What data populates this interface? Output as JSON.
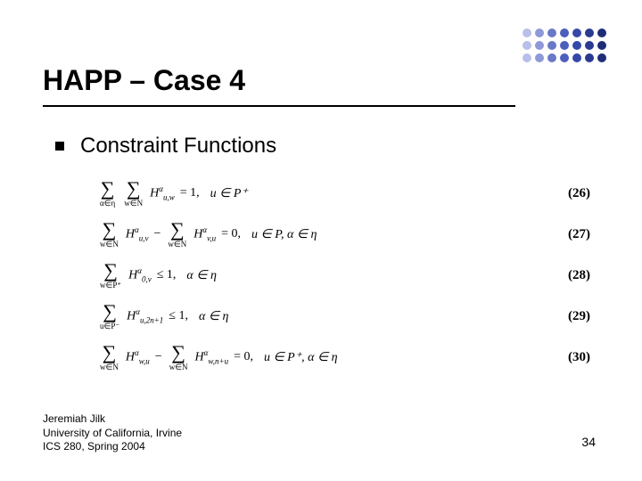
{
  "dot_colors": [
    "#b8bfe8",
    "#8f99d8",
    "#6a78c8",
    "#4d5fbc",
    "#3448a8",
    "#2a3a90",
    "#1f2d78"
  ],
  "title": "HAPP – Case 4",
  "subheading": "Constraint Functions",
  "equations": [
    {
      "sums": [
        {
          "below": "α∈η"
        },
        {
          "below": "w∈N"
        }
      ],
      "term_html": "H<sup>α</sup><sub>u,w</sub>",
      "relation": " = 1, ",
      "condition": "u ∈ P⁺",
      "num": "(26)"
    },
    {
      "lhs_sums": [
        {
          "below": "w∈N"
        }
      ],
      "lhs_term_html": "H<sup>α</sup><sub>u,v</sub>",
      "rhs_sums": [
        {
          "below": "w∈N"
        }
      ],
      "rhs_term_html": "H<sup>α</sup><sub>v,u</sub>",
      "relation": " = 0, ",
      "condition": "u ∈ P, α ∈ η",
      "num": "(27)"
    },
    {
      "sums": [
        {
          "below": "w∈P⁺"
        }
      ],
      "term_html": "H<sup>α</sup><sub>0,v</sub>",
      "relation": " ≤ 1, ",
      "condition": "α ∈ η",
      "num": "(28)"
    },
    {
      "sums": [
        {
          "below": "u∈P⁻"
        }
      ],
      "term_html": "H<sup>α</sup><sub>u,2n+1</sub>",
      "relation": " ≤ 1, ",
      "condition": "α ∈ η",
      "num": "(29)"
    },
    {
      "lhs_sums": [
        {
          "below": "w∈N"
        }
      ],
      "lhs_term_html": "H<sup>α</sup><sub>w,u</sub>",
      "rhs_sums": [
        {
          "below": "w∈N"
        }
      ],
      "rhs_term_html": "H<sup>α</sup><sub>w,n+u</sub>",
      "relation": " = 0, ",
      "condition": "u ∈ P⁺, α ∈ η",
      "num": "(30)"
    }
  ],
  "footer": {
    "line1": "Jeremiah Jilk",
    "line2": "University of California, Irvine",
    "line3": "ICS 280, Spring 2004"
  },
  "page": "34"
}
